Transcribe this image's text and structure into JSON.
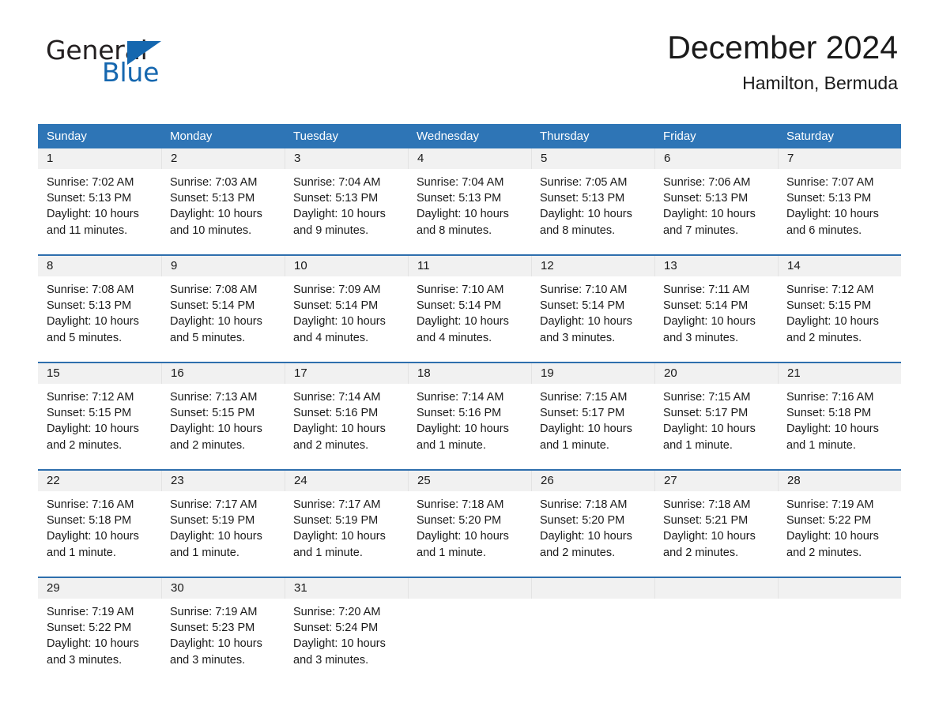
{
  "brand": {
    "name_part1": "General",
    "name_part2": "Blue",
    "triangle_icon": "triangle-icon",
    "accent_color": "#1567af"
  },
  "header": {
    "month_title": "December 2024",
    "location": "Hamilton, Bermuda"
  },
  "theme": {
    "header_blue": "#2e75b6",
    "row_divider_blue": "#2e6fad",
    "day_band_gray": "#f1f1f1",
    "text_color": "#1a1a1a"
  },
  "weekdays": [
    "Sunday",
    "Monday",
    "Tuesday",
    "Wednesday",
    "Thursday",
    "Friday",
    "Saturday"
  ],
  "weeks": [
    [
      {
        "day": "1",
        "sunrise": "Sunrise: 7:02 AM",
        "sunset": "Sunset: 5:13 PM",
        "daylight1": "Daylight: 10 hours",
        "daylight2": "and 11 minutes."
      },
      {
        "day": "2",
        "sunrise": "Sunrise: 7:03 AM",
        "sunset": "Sunset: 5:13 PM",
        "daylight1": "Daylight: 10 hours",
        "daylight2": "and 10 minutes."
      },
      {
        "day": "3",
        "sunrise": "Sunrise: 7:04 AM",
        "sunset": "Sunset: 5:13 PM",
        "daylight1": "Daylight: 10 hours",
        "daylight2": "and 9 minutes."
      },
      {
        "day": "4",
        "sunrise": "Sunrise: 7:04 AM",
        "sunset": "Sunset: 5:13 PM",
        "daylight1": "Daylight: 10 hours",
        "daylight2": "and 8 minutes."
      },
      {
        "day": "5",
        "sunrise": "Sunrise: 7:05 AM",
        "sunset": "Sunset: 5:13 PM",
        "daylight1": "Daylight: 10 hours",
        "daylight2": "and 8 minutes."
      },
      {
        "day": "6",
        "sunrise": "Sunrise: 7:06 AM",
        "sunset": "Sunset: 5:13 PM",
        "daylight1": "Daylight: 10 hours",
        "daylight2": "and 7 minutes."
      },
      {
        "day": "7",
        "sunrise": "Sunrise: 7:07 AM",
        "sunset": "Sunset: 5:13 PM",
        "daylight1": "Daylight: 10 hours",
        "daylight2": "and 6 minutes."
      }
    ],
    [
      {
        "day": "8",
        "sunrise": "Sunrise: 7:08 AM",
        "sunset": "Sunset: 5:13 PM",
        "daylight1": "Daylight: 10 hours",
        "daylight2": "and 5 minutes."
      },
      {
        "day": "9",
        "sunrise": "Sunrise: 7:08 AM",
        "sunset": "Sunset: 5:14 PM",
        "daylight1": "Daylight: 10 hours",
        "daylight2": "and 5 minutes."
      },
      {
        "day": "10",
        "sunrise": "Sunrise: 7:09 AM",
        "sunset": "Sunset: 5:14 PM",
        "daylight1": "Daylight: 10 hours",
        "daylight2": "and 4 minutes."
      },
      {
        "day": "11",
        "sunrise": "Sunrise: 7:10 AM",
        "sunset": "Sunset: 5:14 PM",
        "daylight1": "Daylight: 10 hours",
        "daylight2": "and 4 minutes."
      },
      {
        "day": "12",
        "sunrise": "Sunrise: 7:10 AM",
        "sunset": "Sunset: 5:14 PM",
        "daylight1": "Daylight: 10 hours",
        "daylight2": "and 3 minutes."
      },
      {
        "day": "13",
        "sunrise": "Sunrise: 7:11 AM",
        "sunset": "Sunset: 5:14 PM",
        "daylight1": "Daylight: 10 hours",
        "daylight2": "and 3 minutes."
      },
      {
        "day": "14",
        "sunrise": "Sunrise: 7:12 AM",
        "sunset": "Sunset: 5:15 PM",
        "daylight1": "Daylight: 10 hours",
        "daylight2": "and 2 minutes."
      }
    ],
    [
      {
        "day": "15",
        "sunrise": "Sunrise: 7:12 AM",
        "sunset": "Sunset: 5:15 PM",
        "daylight1": "Daylight: 10 hours",
        "daylight2": "and 2 minutes."
      },
      {
        "day": "16",
        "sunrise": "Sunrise: 7:13 AM",
        "sunset": "Sunset: 5:15 PM",
        "daylight1": "Daylight: 10 hours",
        "daylight2": "and 2 minutes."
      },
      {
        "day": "17",
        "sunrise": "Sunrise: 7:14 AM",
        "sunset": "Sunset: 5:16 PM",
        "daylight1": "Daylight: 10 hours",
        "daylight2": "and 2 minutes."
      },
      {
        "day": "18",
        "sunrise": "Sunrise: 7:14 AM",
        "sunset": "Sunset: 5:16 PM",
        "daylight1": "Daylight: 10 hours",
        "daylight2": "and 1 minute."
      },
      {
        "day": "19",
        "sunrise": "Sunrise: 7:15 AM",
        "sunset": "Sunset: 5:17 PM",
        "daylight1": "Daylight: 10 hours",
        "daylight2": "and 1 minute."
      },
      {
        "day": "20",
        "sunrise": "Sunrise: 7:15 AM",
        "sunset": "Sunset: 5:17 PM",
        "daylight1": "Daylight: 10 hours",
        "daylight2": "and 1 minute."
      },
      {
        "day": "21",
        "sunrise": "Sunrise: 7:16 AM",
        "sunset": "Sunset: 5:18 PM",
        "daylight1": "Daylight: 10 hours",
        "daylight2": "and 1 minute."
      }
    ],
    [
      {
        "day": "22",
        "sunrise": "Sunrise: 7:16 AM",
        "sunset": "Sunset: 5:18 PM",
        "daylight1": "Daylight: 10 hours",
        "daylight2": "and 1 minute."
      },
      {
        "day": "23",
        "sunrise": "Sunrise: 7:17 AM",
        "sunset": "Sunset: 5:19 PM",
        "daylight1": "Daylight: 10 hours",
        "daylight2": "and 1 minute."
      },
      {
        "day": "24",
        "sunrise": "Sunrise: 7:17 AM",
        "sunset": "Sunset: 5:19 PM",
        "daylight1": "Daylight: 10 hours",
        "daylight2": "and 1 minute."
      },
      {
        "day": "25",
        "sunrise": "Sunrise: 7:18 AM",
        "sunset": "Sunset: 5:20 PM",
        "daylight1": "Daylight: 10 hours",
        "daylight2": "and 1 minute."
      },
      {
        "day": "26",
        "sunrise": "Sunrise: 7:18 AM",
        "sunset": "Sunset: 5:20 PM",
        "daylight1": "Daylight: 10 hours",
        "daylight2": "and 2 minutes."
      },
      {
        "day": "27",
        "sunrise": "Sunrise: 7:18 AM",
        "sunset": "Sunset: 5:21 PM",
        "daylight1": "Daylight: 10 hours",
        "daylight2": "and 2 minutes."
      },
      {
        "day": "28",
        "sunrise": "Sunrise: 7:19 AM",
        "sunset": "Sunset: 5:22 PM",
        "daylight1": "Daylight: 10 hours",
        "daylight2": "and 2 minutes."
      }
    ],
    [
      {
        "day": "29",
        "sunrise": "Sunrise: 7:19 AM",
        "sunset": "Sunset: 5:22 PM",
        "daylight1": "Daylight: 10 hours",
        "daylight2": "and 3 minutes."
      },
      {
        "day": "30",
        "sunrise": "Sunrise: 7:19 AM",
        "sunset": "Sunset: 5:23 PM",
        "daylight1": "Daylight: 10 hours",
        "daylight2": "and 3 minutes."
      },
      {
        "day": "31",
        "sunrise": "Sunrise: 7:20 AM",
        "sunset": "Sunset: 5:24 PM",
        "daylight1": "Daylight: 10 hours",
        "daylight2": "and 3 minutes."
      },
      {
        "day": "",
        "sunrise": "",
        "sunset": "",
        "daylight1": "",
        "daylight2": ""
      },
      {
        "day": "",
        "sunrise": "",
        "sunset": "",
        "daylight1": "",
        "daylight2": ""
      },
      {
        "day": "",
        "sunrise": "",
        "sunset": "",
        "daylight1": "",
        "daylight2": ""
      },
      {
        "day": "",
        "sunrise": "",
        "sunset": "",
        "daylight1": "",
        "daylight2": ""
      }
    ]
  ]
}
